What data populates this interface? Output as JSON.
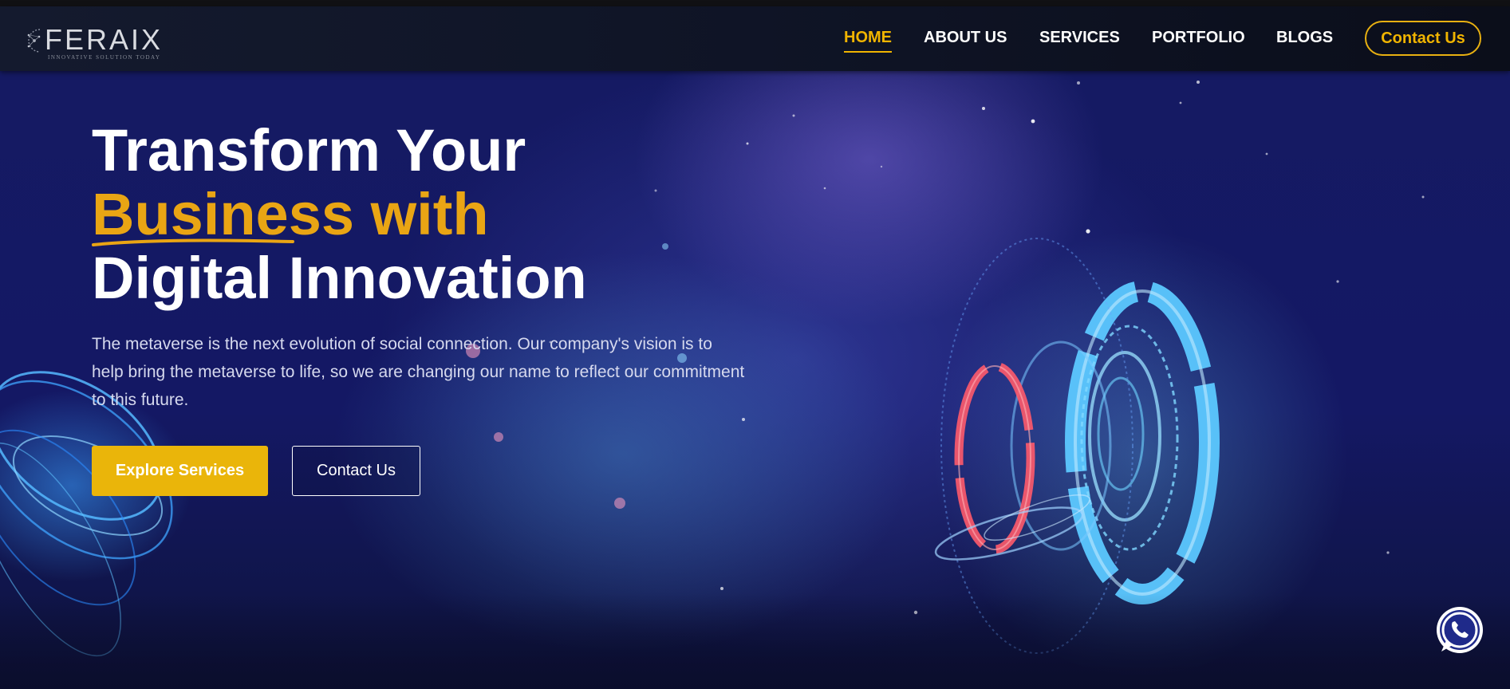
{
  "brand": {
    "name": "FERAIX",
    "tagline": "INNOVATIVE SOLUTION TODAY"
  },
  "nav": {
    "items": [
      {
        "label": "HOME",
        "active": true
      },
      {
        "label": "ABOUT US",
        "active": false
      },
      {
        "label": "SERVICES",
        "active": false
      },
      {
        "label": "PORTFOLIO",
        "active": false
      },
      {
        "label": "BLOGS",
        "active": false
      }
    ],
    "contact_label": "Contact Us"
  },
  "hero": {
    "headline_line1": "Transform Your",
    "headline_line2": "Business with",
    "headline_line3": "Digital Innovation",
    "intro": "The metaverse is the next evolution of social connection. Our company's vision is to help bring the metaverse to life, so we are changing our name to reflect our commitment to this future.",
    "primary_button": "Explore Services",
    "secondary_button": "Contact Us"
  },
  "icons": {
    "logo": "feraix-logo-icon",
    "chat": "whatsapp-icon"
  },
  "colors": {
    "accent": "#eab50a",
    "nav_background": "#11162a",
    "hero_background": "#151a63"
  }
}
